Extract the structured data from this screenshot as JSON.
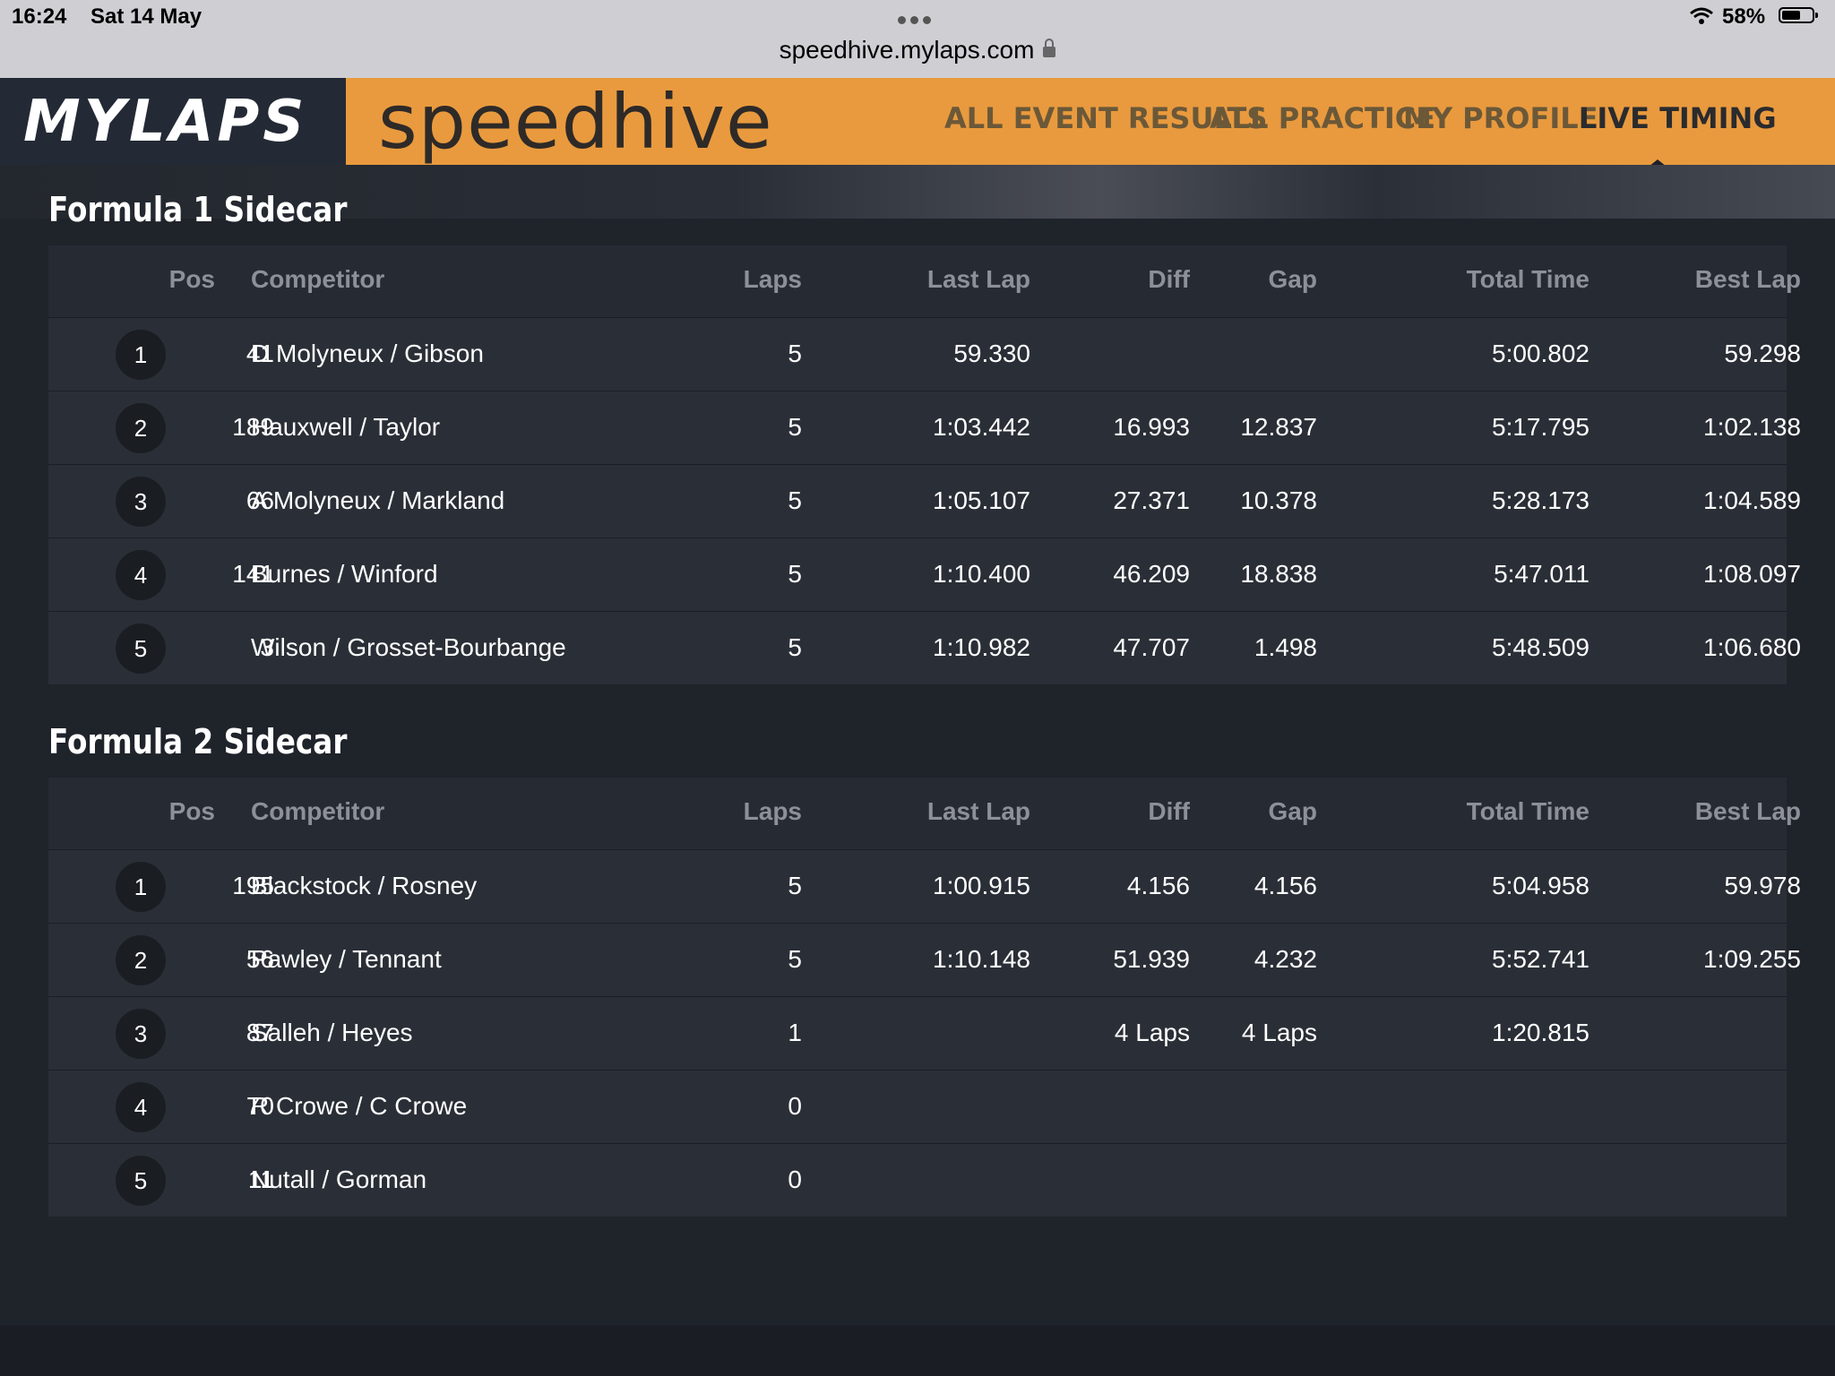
{
  "status_bar": {
    "time": "16:24",
    "date": "Sat 14 May",
    "url": "speedhive.mylaps.com",
    "battery": "58%"
  },
  "header": {
    "logo": "MYLAPS",
    "brand": "speedhive",
    "nav": [
      "ALL EVENT RESULTS",
      "ALL PRACTICE",
      "MY PROFILE",
      "LIVE TIMING"
    ],
    "active_nav": "LIVE TIMING"
  },
  "columns": [
    "Pos",
    "Competitor",
    "Laps",
    "Last Lap",
    "Diff",
    "Gap",
    "Total Time",
    "Best Lap"
  ],
  "sections": [
    {
      "title": "Formula 1 Sidecar",
      "rows": [
        {
          "pos": "1",
          "num": "41",
          "competitor": "D Molyneux / Gibson",
          "laps": "5",
          "last": "59.330",
          "diff": "",
          "gap": "",
          "total": "5:00.802",
          "best": "59.298"
        },
        {
          "pos": "2",
          "num": "189",
          "competitor": "Hauxwell / Taylor",
          "laps": "5",
          "last": "1:03.442",
          "diff": "16.993",
          "gap": "12.837",
          "total": "5:17.795",
          "best": "1:02.138"
        },
        {
          "pos": "3",
          "num": "66",
          "competitor": "A Molyneux / Markland",
          "laps": "5",
          "last": "1:05.107",
          "diff": "27.371",
          "gap": "10.378",
          "total": "5:28.173",
          "best": "1:04.589"
        },
        {
          "pos": "4",
          "num": "141",
          "competitor": "Burnes / Winford",
          "laps": "5",
          "last": "1:10.400",
          "diff": "46.209",
          "gap": "18.838",
          "total": "5:47.011",
          "best": "1:08.097"
        },
        {
          "pos": "5",
          "num": "3",
          "competitor": "Wilson / Grosset-Bourbange",
          "laps": "5",
          "last": "1:10.982",
          "diff": "47.707",
          "gap": "1.498",
          "total": "5:48.509",
          "best": "1:06.680"
        }
      ]
    },
    {
      "title": "Formula 2 Sidecar",
      "rows": [
        {
          "pos": "1",
          "num": "195",
          "competitor": "Blackstock / Rosney",
          "laps": "5",
          "last": "1:00.915",
          "diff": "4.156",
          "gap": "4.156",
          "total": "5:04.958",
          "best": "59.978"
        },
        {
          "pos": "2",
          "num": "56",
          "competitor": "Pawley / Tennant",
          "laps": "5",
          "last": "1:10.148",
          "diff": "51.939",
          "gap": "4.232",
          "total": "5:52.741",
          "best": "1:09.255"
        },
        {
          "pos": "3",
          "num": "87",
          "competitor": "Salleh / Heyes",
          "laps": "1",
          "last": "",
          "diff": "4 Laps",
          "gap": "4 Laps",
          "total": "1:20.815",
          "best": ""
        },
        {
          "pos": "4",
          "num": "70",
          "competitor": "R Crowe / C Crowe",
          "laps": "0",
          "last": "",
          "diff": "",
          "gap": "",
          "total": "",
          "best": ""
        },
        {
          "pos": "5",
          "num": "11",
          "competitor": "Nutall / Gorman",
          "laps": "0",
          "last": "",
          "diff": "",
          "gap": "",
          "total": "",
          "best": ""
        }
      ]
    }
  ]
}
